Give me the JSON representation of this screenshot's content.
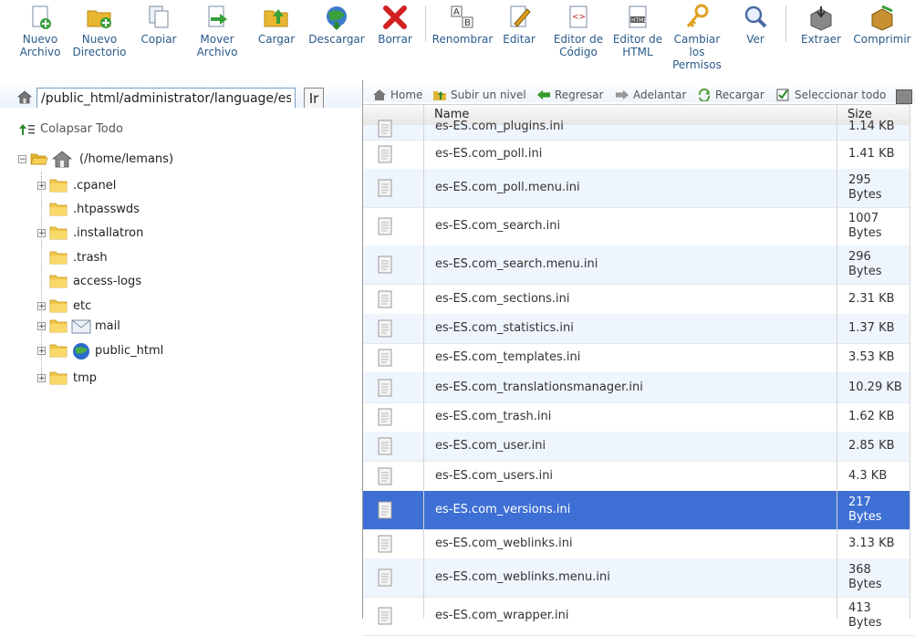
{
  "toolbar": {
    "buttons": [
      {
        "label": "Nuevo\nArchivo",
        "icon": "new-file-icon"
      },
      {
        "label": "Nuevo\nDirectorio",
        "icon": "new-folder-icon"
      },
      {
        "label": "Copiar",
        "icon": "copy-icon"
      },
      {
        "label": "Mover\nArchivo",
        "icon": "move-icon"
      },
      {
        "label": "Cargar",
        "icon": "upload-icon"
      },
      {
        "label": "Descargar",
        "icon": "download-icon"
      },
      {
        "label": "Borrar",
        "icon": "delete-icon"
      },
      {
        "label": "Renombrar",
        "icon": "rename-icon"
      },
      {
        "label": "Editar",
        "icon": "edit-icon"
      },
      {
        "label": "Editor de\nCódigo",
        "icon": "code-editor-icon"
      },
      {
        "label": "Editor de\nHTML",
        "icon": "html-editor-icon"
      },
      {
        "label": "Cambiar\nlos\nPermisos",
        "icon": "permissions-icon"
      },
      {
        "label": "Ver",
        "icon": "view-icon"
      },
      {
        "label": "Extraer",
        "icon": "extract-icon"
      },
      {
        "label": "Comprimir",
        "icon": "compress-icon"
      }
    ]
  },
  "path": {
    "value": "/public_html/administrator/language/es-ES",
    "go_label": "Ir"
  },
  "tree": {
    "collapse_label": "Colapsar Todo",
    "root_label": "(/home/lemans)",
    "items": [
      {
        "label": ".cpanel",
        "expandable": true
      },
      {
        "label": ".htpasswds",
        "expandable": false
      },
      {
        "label": ".installatron",
        "expandable": true
      },
      {
        "label": ".trash",
        "expandable": false
      },
      {
        "label": "access-logs",
        "expandable": false
      },
      {
        "label": "etc",
        "expandable": true
      },
      {
        "label": "mail",
        "expandable": true
      },
      {
        "label": "public_html",
        "expandable": true
      },
      {
        "label": "tmp",
        "expandable": true
      }
    ]
  },
  "nav": {
    "home": "Home",
    "up": "Subir un nivel",
    "back": "Regresar",
    "forward": "Adelantar",
    "reload": "Recargar",
    "select_all": "Seleccionar todo"
  },
  "table": {
    "col_name": "Name",
    "col_size": "Size",
    "rows": [
      {
        "name": "es-ES.com_plugins.ini",
        "size": "1.14 KB",
        "h": 16,
        "partial": true
      },
      {
        "name": "es-ES.com_poll.ini",
        "size": "1.41 KB",
        "h": 32
      },
      {
        "name": "es-ES.com_poll.menu.ini",
        "size": "295\nBytes",
        "h": 42
      },
      {
        "name": "es-ES.com_search.ini",
        "size": "1007\nBytes",
        "h": 42
      },
      {
        "name": "es-ES.com_search.menu.ini",
        "size": "296\nBytes",
        "h": 42
      },
      {
        "name": "es-ES.com_sections.ini",
        "size": "2.31 KB",
        "h": 33
      },
      {
        "name": "es-ES.com_statistics.ini",
        "size": "1.37 KB",
        "h": 32
      },
      {
        "name": "es-ES.com_templates.ini",
        "size": "3.53 KB",
        "h": 32
      },
      {
        "name": "es-ES.com_translationsmanager.ini",
        "size": "10.29 KB",
        "h": 33
      },
      {
        "name": "es-ES.com_trash.ini",
        "size": "1.62 KB",
        "h": 32
      },
      {
        "name": "es-ES.com_user.ini",
        "size": "2.85 KB",
        "h": 32
      },
      {
        "name": "es-ES.com_users.ini",
        "size": "4.3 KB",
        "h": 33
      },
      {
        "name": "es-ES.com_versions.ini",
        "size": "217\nBytes",
        "h": 42,
        "selected": true
      },
      {
        "name": "es-ES.com_weblinks.ini",
        "size": "3.13 KB",
        "h": 32
      },
      {
        "name": "es-ES.com_weblinks.menu.ini",
        "size": "368\nBytes",
        "h": 42
      },
      {
        "name": "es-ES.com_wrapper.ini",
        "size": "413\nBytes",
        "h": 42
      }
    ]
  },
  "colors": {
    "toolbar_text": "#2a5a8a",
    "selection": "#3e6fd4",
    "row_alt": "#eef5fc"
  }
}
